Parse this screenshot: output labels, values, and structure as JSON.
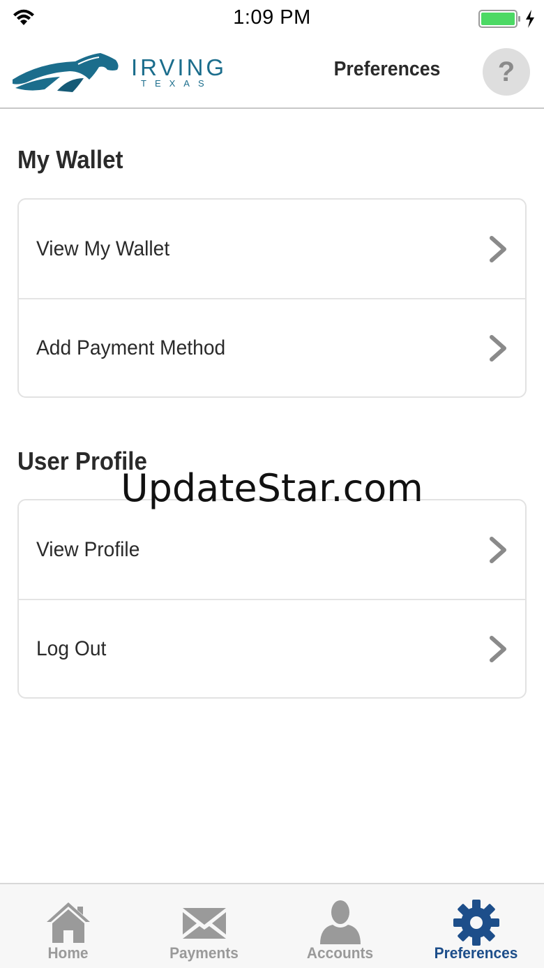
{
  "status_bar": {
    "time": "1:09 PM",
    "wifi_icon": "wifi-icon",
    "battery_icon": "battery-charging-icon"
  },
  "header": {
    "logo": {
      "word": "IRVING",
      "sub": "TEXAS"
    },
    "title": "Preferences",
    "help_label": "?"
  },
  "sections": [
    {
      "title": "My Wallet",
      "items": [
        {
          "label": "View My Wallet"
        },
        {
          "label": "Add Payment Method"
        }
      ]
    },
    {
      "title": "User Profile",
      "items": [
        {
          "label": "View Profile"
        },
        {
          "label": "Log Out"
        }
      ]
    }
  ],
  "watermark": "UpdateStar.com",
  "tab_bar": {
    "tabs": [
      {
        "label": "Home",
        "icon": "home-icon",
        "active": false
      },
      {
        "label": "Payments",
        "icon": "envelope-icon",
        "active": false
      },
      {
        "label": "Accounts",
        "icon": "user-icon",
        "active": false
      },
      {
        "label": "Preferences",
        "icon": "gear-icon",
        "active": true
      }
    ]
  },
  "colors": {
    "brand": "#1b6d8c",
    "active_tab": "#1d4e8a",
    "inactive_tab": "#9a9a9a",
    "battery": "#4cd964"
  }
}
